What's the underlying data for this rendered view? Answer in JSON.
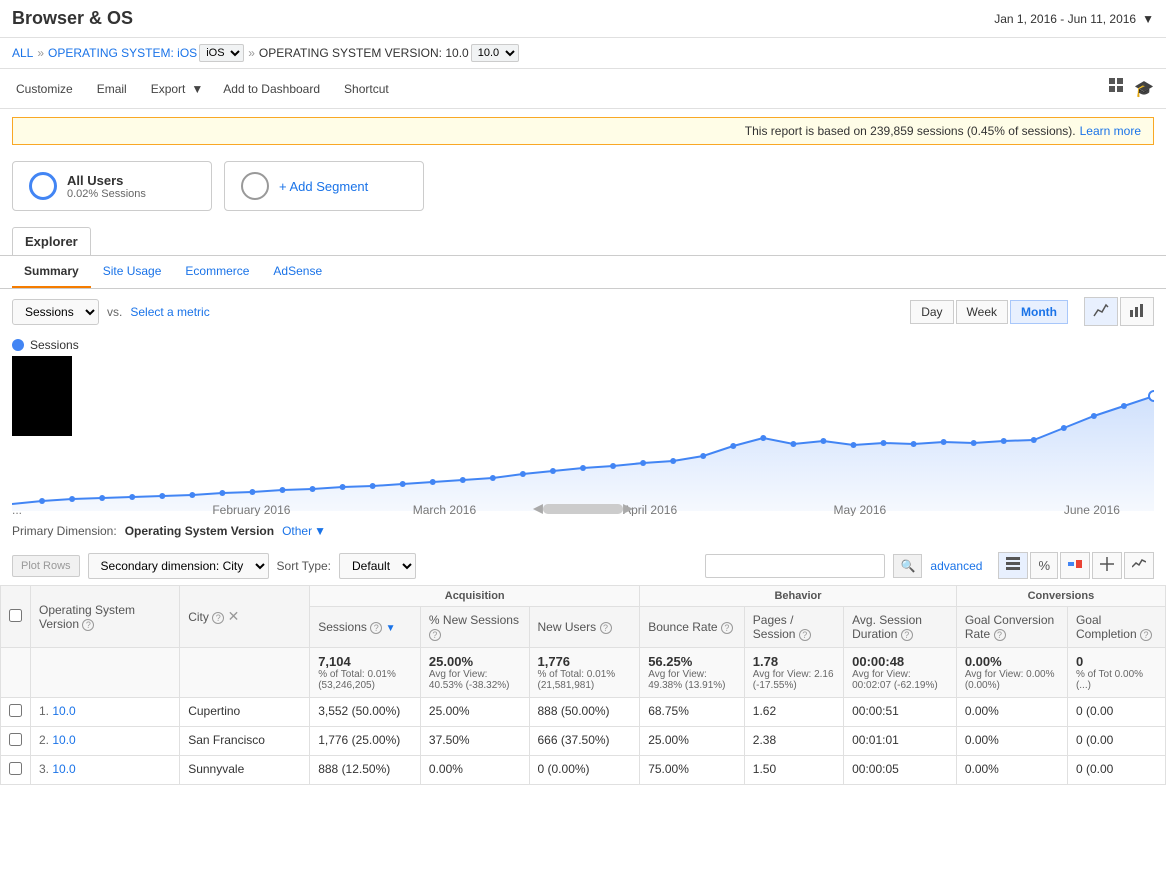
{
  "header": {
    "title": "Browser & OS",
    "date_range": "Jan 1, 2016 - Jun 11, 2016"
  },
  "breadcrumb": {
    "all": "ALL",
    "os_label": "OPERATING SYSTEM: iOS",
    "os_version_label": "OPERATING SYSTEM VERSION: 10.0"
  },
  "toolbar": {
    "customize": "Customize",
    "email": "Email",
    "export": "Export",
    "add_to_dashboard": "Add to Dashboard",
    "shortcut": "Shortcut"
  },
  "alert": {
    "message": "This report is based on 239,859 sessions (0.45% of sessions).",
    "link_text": "Learn more"
  },
  "segments": {
    "all_users": {
      "name": "All Users",
      "sub": "0.02% Sessions"
    },
    "add_segment": "+ Add Segment"
  },
  "tabs": {
    "explorer": "Explorer",
    "sub_tabs": [
      "Summary",
      "Site Usage",
      "Ecommerce",
      "AdSense"
    ]
  },
  "chart": {
    "metric_select": "Sessions",
    "vs_label": "vs.",
    "select_metric": "Select a metric",
    "time_buttons": [
      "Day",
      "Week",
      "Month"
    ],
    "active_time": "Month",
    "sessions_label": "Sessions",
    "x_labels": [
      "...",
      "February 2016",
      "March 2016",
      "April 2016",
      "May 2016",
      "June 2016"
    ]
  },
  "primary_dimension": {
    "label": "Primary Dimension:",
    "value": "Operating System Version",
    "other": "Other"
  },
  "table_controls": {
    "plot_rows": "Plot Rows",
    "secondary_dim": "Secondary dimension: City",
    "sort_type_label": "Sort Type:",
    "sort_default": "Default",
    "search_placeholder": "",
    "advanced": "advanced"
  },
  "table": {
    "col_groups": {
      "acquisition": "Acquisition",
      "behavior": "Behavior",
      "conversions": "Conversions"
    },
    "headers": {
      "os_version": "Operating System Version",
      "city": "City",
      "sessions": "Sessions",
      "pct_new_sessions": "% New Sessions",
      "new_users": "New Users",
      "bounce_rate": "Bounce Rate",
      "pages_session": "Pages / Session",
      "avg_session_duration": "Avg. Session Duration",
      "goal_conversion_rate": "Goal Conversion Rate",
      "goal_completion": "Goal Completion"
    },
    "totals": {
      "sessions": "7,104",
      "sessions_pct": "% of Total: 0.01% (53,246,205)",
      "pct_new_sessions": "25.00%",
      "pct_new_avg": "Avg for View: 40.53% (-38.32%)",
      "new_users": "1,776",
      "new_users_pct": "% of Total: 0.01% (21,581,981)",
      "bounce_rate": "56.25%",
      "bounce_avg": "Avg for View: 49.38% (13.91%)",
      "pages_session": "1.78",
      "pages_avg": "Avg for View: 2.16 (-17.55%)",
      "avg_duration": "00:00:48",
      "duration_avg": "Avg for View: 00:02:07 (-62.19%)",
      "goal_conv_rate": "0.00%",
      "goal_conv_avg": "Avg for View: 0.00% (0.00%)",
      "goal_completion": "0",
      "goal_comp_pct": "% of Tot 0.00% (...)"
    },
    "rows": [
      {
        "num": "1.",
        "os_version": "10.0",
        "city": "Cupertino",
        "sessions": "3,552",
        "sessions_pct": "50.00%",
        "pct_new_sessions": "25.00%",
        "new_users": "888",
        "new_users_pct": "50.00%",
        "bounce_rate": "68.75%",
        "pages_session": "1.62",
        "avg_duration": "00:00:51",
        "goal_conv_rate": "0.00%",
        "goal_completion": "0",
        "goal_comp_extra": "(0.00"
      },
      {
        "num": "2.",
        "os_version": "10.0",
        "city": "San Francisco",
        "sessions": "1,776",
        "sessions_pct": "25.00%",
        "pct_new_sessions": "37.50%",
        "new_users": "666",
        "new_users_pct": "37.50%",
        "bounce_rate": "25.00%",
        "pages_session": "2.38",
        "avg_duration": "00:01:01",
        "goal_conv_rate": "0.00%",
        "goal_completion": "0",
        "goal_comp_extra": "(0.00"
      },
      {
        "num": "3.",
        "os_version": "10.0",
        "city": "Sunnyvale",
        "sessions": "888",
        "sessions_pct": "12.50%",
        "pct_new_sessions": "0.00%",
        "new_users": "0",
        "new_users_pct": "0.00%",
        "bounce_rate": "75.00%",
        "pages_session": "1.50",
        "avg_duration": "00:00:05",
        "goal_conv_rate": "0.00%",
        "goal_completion": "0",
        "goal_comp_extra": "(0.00"
      }
    ]
  }
}
